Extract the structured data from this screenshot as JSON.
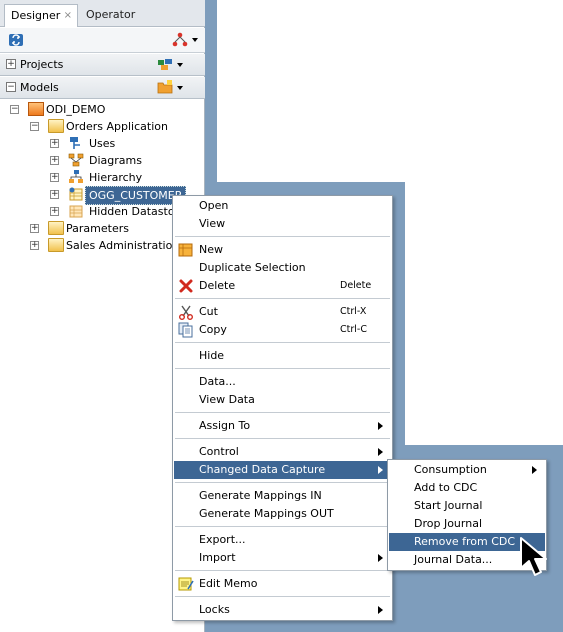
{
  "tabs": [
    {
      "label": "Designer",
      "close": "×"
    },
    {
      "label": "Operator"
    }
  ],
  "accordions": {
    "projects": {
      "sign": "+",
      "label": "Projects"
    },
    "models": {
      "sign": "−",
      "label": "Models"
    }
  },
  "tree": {
    "root": {
      "label": "ODI_DEMO",
      "expander": "−"
    },
    "orders": {
      "label": "Orders Application",
      "expander": "−"
    },
    "uses": {
      "label": "Uses",
      "expander": "+"
    },
    "diagrams": {
      "label": "Diagrams",
      "expander": "+"
    },
    "hierarchy": {
      "label": "Hierarchy",
      "expander": "+"
    },
    "ogg_customer": {
      "label": "OGG_CUSTOMER",
      "expander": "+"
    },
    "hidden": {
      "label": "Hidden Datastores",
      "expander": "+"
    },
    "parameters": {
      "label": "Parameters",
      "expander": "+"
    },
    "sales_admin": {
      "label": "Sales Administration",
      "expander": "+"
    }
  },
  "context_menu": {
    "open": "Open",
    "view": "View",
    "new": "New",
    "duplicate_selection": "Duplicate Selection",
    "delete": "Delete",
    "delete_shortcut": "Delete",
    "cut": "Cut",
    "cut_shortcut": "Ctrl-X",
    "copy": "Copy",
    "copy_shortcut": "Ctrl-C",
    "hide": "Hide",
    "data": "Data...",
    "view_data": "View Data",
    "assign_to": "Assign To",
    "control": "Control",
    "changed_data_capture": "Changed Data Capture",
    "generate_mappings_in": "Generate Mappings IN",
    "generate_mappings_out": "Generate Mappings OUT",
    "export": "Export...",
    "import": "Import",
    "edit_memo": "Edit Memo",
    "locks": "Locks"
  },
  "cdc_submenu": {
    "consumption": "Consumption",
    "add_to_cdc": "Add to CDC",
    "start_journal": "Start Journal",
    "drop_journal": "Drop Journal",
    "remove_from_cdc": "Remove from CDC",
    "journal_data": "Journal Data..."
  },
  "colors": {
    "highlight": "#3d6694",
    "background_frame": "#7e9dbc"
  }
}
